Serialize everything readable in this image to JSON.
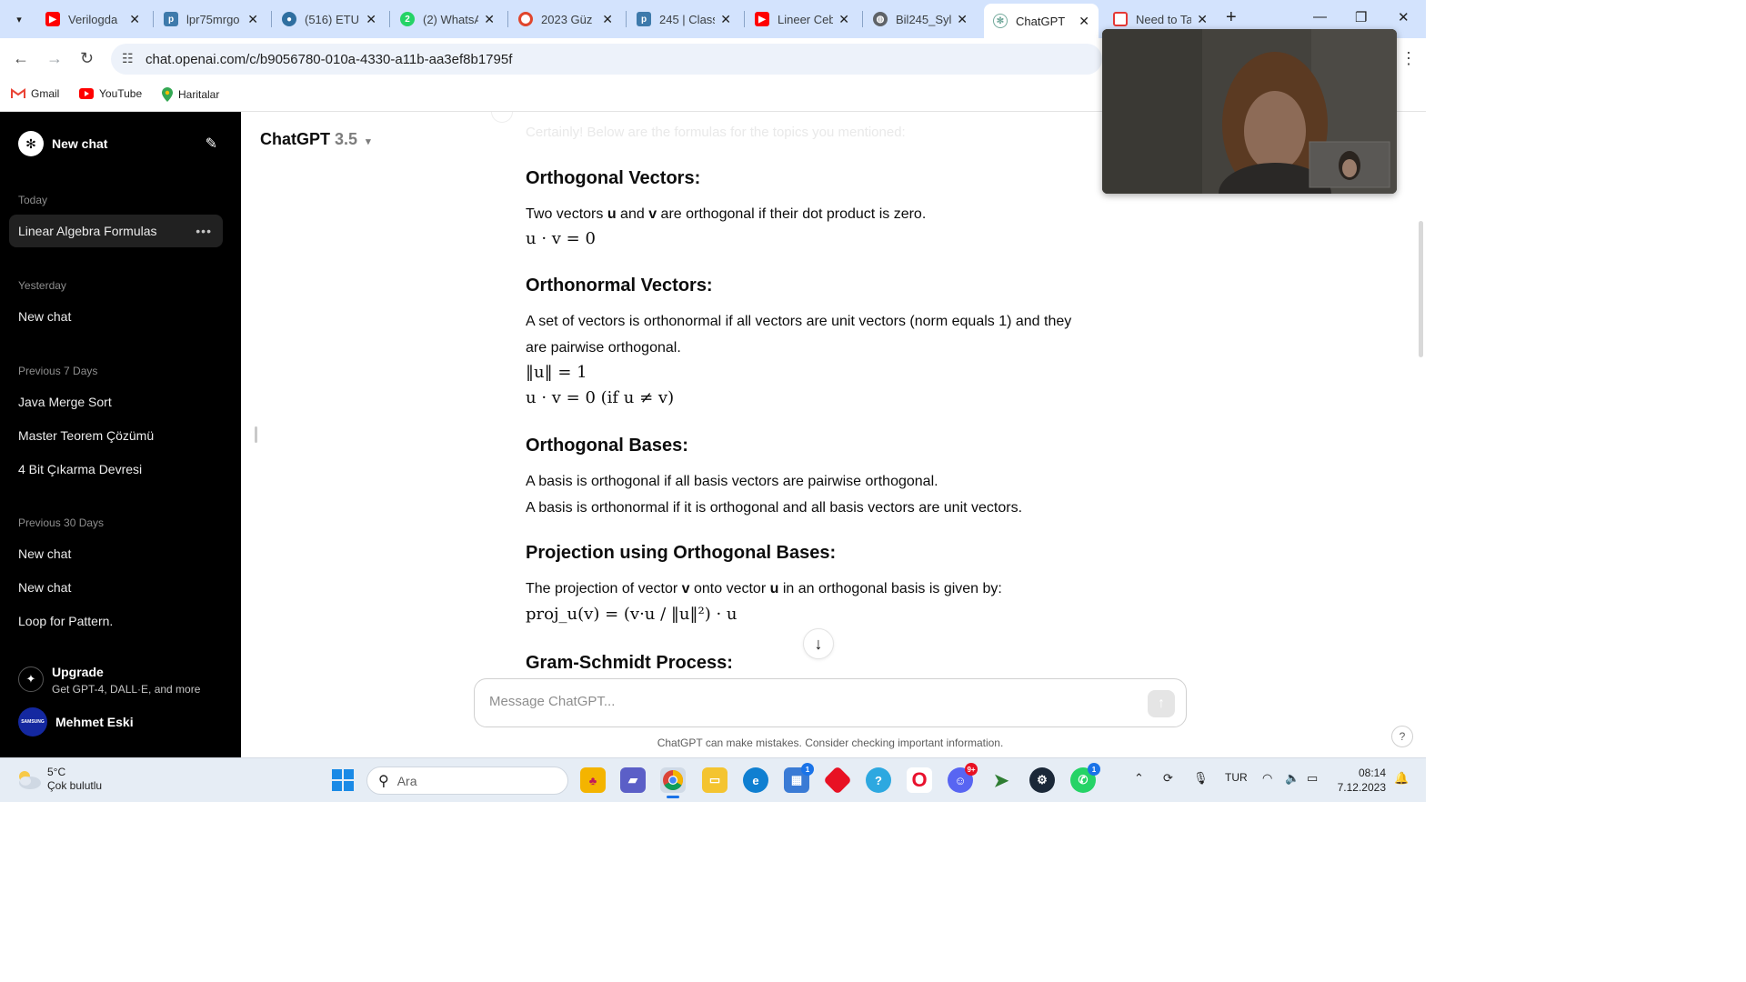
{
  "browser": {
    "tabs": [
      {
        "label": "Verilogda",
        "icon": "youtube-icon",
        "color": "#ff0000"
      },
      {
        "label": "lpr75mrgo",
        "icon": "piazza-icon",
        "color": "#3e7aab"
      },
      {
        "label": "(516) ETU",
        "icon": "etu-icon",
        "color": "#2f6fa0"
      },
      {
        "label": "(2) WhatsA",
        "icon": "whatsapp-icon",
        "color": "#25d366"
      },
      {
        "label": "2023 Güz",
        "icon": "circle-icon",
        "color": "#e0452c"
      },
      {
        "label": "245 | Class",
        "icon": "piazza-icon",
        "color": "#3e7aab"
      },
      {
        "label": "Lineer Ceb",
        "icon": "youtube-icon",
        "color": "#ff0000"
      },
      {
        "label": "Bil245_Syll",
        "icon": "globe-icon",
        "color": "#5f6368"
      },
      {
        "label": "ChatGPT",
        "icon": "chatgpt-icon",
        "color": "#74aa9c"
      },
      {
        "label": "Need to Ta",
        "icon": "c-icon",
        "color": "#e53935"
      }
    ],
    "url": "chat.openai.com/c/b9056780-010a-4330-a11b-aa3ef8b1795f",
    "bookmarks": [
      {
        "label": "Gmail",
        "icon": "gmail-icon"
      },
      {
        "label": "YouTube",
        "icon": "youtube-icon"
      },
      {
        "label": "Haritalar",
        "icon": "maps-pin-icon"
      }
    ]
  },
  "sidebar": {
    "new_chat": "New chat",
    "sections": [
      {
        "title": "Today",
        "items": [
          "Linear Algebra Formulas"
        ]
      },
      {
        "title": "Yesterday",
        "items": [
          "New chat"
        ]
      },
      {
        "title": "Previous 7 Days",
        "items": [
          "Java Merge Sort",
          "Master Teorem Çözümü",
          "4 Bit Çıkarma Devresi"
        ]
      },
      {
        "title": "Previous 30 Days",
        "items": [
          "New chat",
          "New chat",
          "Loop for Pattern."
        ]
      }
    ],
    "upgrade_title": "Upgrade",
    "upgrade_sub": "Get GPT-4, DALL·E, and more",
    "user_name": "Mehmet Eski",
    "avatar_text": "SAMSUNG"
  },
  "main": {
    "model_name": "ChatGPT",
    "model_version": "3.5",
    "faded_intro": "Certainly! Below are the formulas for the topics you mentioned:",
    "sections": {
      "orthogonal_vectors": {
        "heading": "Orthogonal Vectors:",
        "text_pre": "Two vectors ",
        "text_u": "u",
        "text_mid": " and ",
        "text_v": "v",
        "text_post": " are orthogonal if their dot product is zero.",
        "formula": "u · v = 0"
      },
      "orthonormal_vectors": {
        "heading": "Orthonormal Vectors:",
        "text": "A set of vectors is orthonormal if all vectors are unit vectors (norm equals 1) and they are pairwise orthogonal.",
        "formula_1": "‖u‖ = 1",
        "formula_2": "u · v = 0 (if u ≠ v)"
      },
      "orthogonal_bases": {
        "heading": "Orthogonal Bases:",
        "line_1": "A basis is orthogonal if all basis vectors are pairwise orthogonal.",
        "line_2": "A basis is orthonormal if it is orthogonal and all basis vectors are unit vectors."
      },
      "projection": {
        "heading": "Projection using Orthogonal Bases:",
        "text_pre": "The projection of vector ",
        "text_v": "v",
        "text_mid": " onto vector ",
        "text_u": "u",
        "text_post": " in an orthogonal basis is given by:",
        "formula": "proj_u(v) = (v·u / ‖u‖²) · u"
      },
      "gram_schmidt": {
        "heading": "Gram-Schmidt Process:"
      }
    },
    "composer_placeholder": "Message ChatGPT...",
    "disclaimer": "ChatGPT can make mistakes. Consider checking important information.",
    "help_label": "?"
  },
  "taskbar": {
    "weather_temp": "5°C",
    "weather_desc": "Çok bulutlu",
    "search_label": "Ara",
    "apps": [
      {
        "name": "widgets-app-icon",
        "badge": ""
      },
      {
        "name": "cards-app-icon",
        "badge": ""
      },
      {
        "name": "video-call-app-icon",
        "badge": ""
      },
      {
        "name": "chrome-app-icon",
        "badge": ""
      },
      {
        "name": "file-explorer-app-icon",
        "badge": ""
      },
      {
        "name": "edge-app-icon",
        "badge": ""
      },
      {
        "name": "store-app-icon",
        "badge": "1"
      },
      {
        "name": "red-diamond-app-icon",
        "badge": ""
      },
      {
        "name": "copilot-app-icon",
        "badge": ""
      },
      {
        "name": "opera-app-icon",
        "badge": ""
      },
      {
        "name": "discord-app-icon",
        "badge": "9+"
      },
      {
        "name": "jupiter-app-icon",
        "badge": ""
      },
      {
        "name": "steam-app-icon",
        "badge": ""
      },
      {
        "name": "whatsapp-app-icon",
        "badge": "1"
      }
    ],
    "language": "TUR",
    "time": "08:14",
    "date": "7.12.2023"
  },
  "colors": {
    "tabbar": "#d3e3fd",
    "sidebar": "#000000",
    "accent_youtube": "#ff0000"
  }
}
